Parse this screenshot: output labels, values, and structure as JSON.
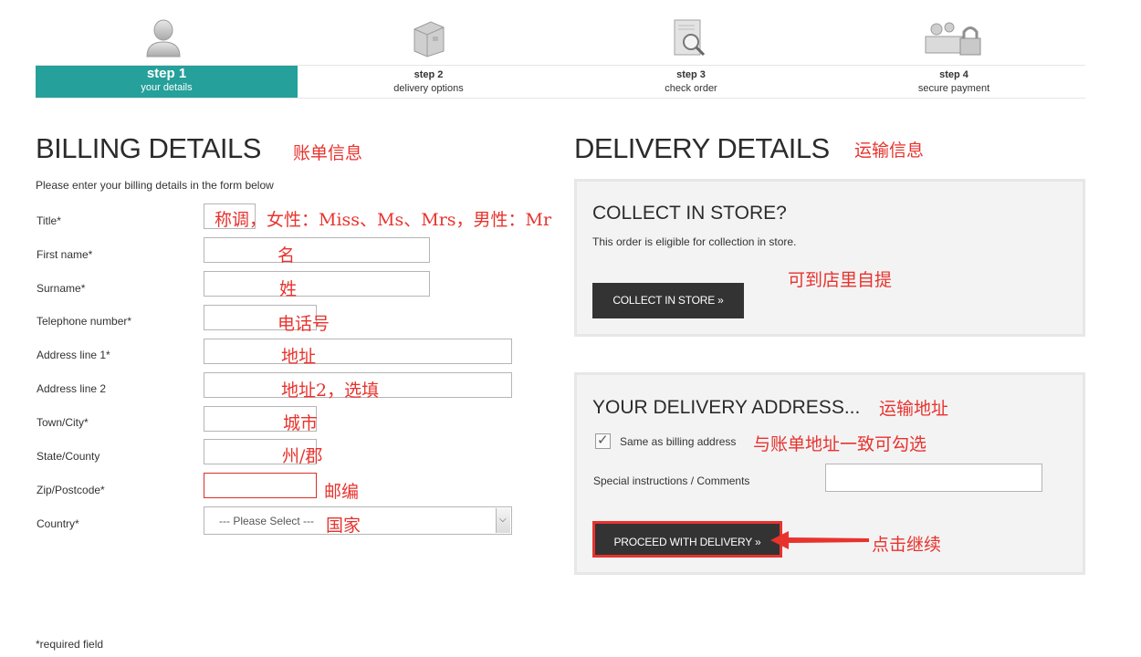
{
  "steps": [
    {
      "title": "step 1",
      "subtitle": "your details",
      "icon": "user-icon",
      "active": true
    },
    {
      "title": "step 2",
      "subtitle": "delivery options",
      "icon": "package-icon",
      "active": false
    },
    {
      "title": "step 3",
      "subtitle": "check order",
      "icon": "magnifier-document-icon",
      "active": false
    },
    {
      "title": "step 4",
      "subtitle": "secure payment",
      "icon": "padlock-money-icon",
      "active": false
    }
  ],
  "billing": {
    "heading": "BILLING DETAILS",
    "heading_note": "账单信息",
    "intro": "Please enter your billing details in the form below",
    "fields": {
      "title": {
        "label": "Title*",
        "note": "称调，女性：Miss、Ms、Mrs，男性：Mr"
      },
      "first_name": {
        "label": "First name*",
        "note": "名"
      },
      "surname": {
        "label": "Surname*",
        "note": "姓"
      },
      "telephone": {
        "label": "Telephone number*",
        "note": "电话号"
      },
      "address1": {
        "label": "Address line 1*",
        "note": "地址"
      },
      "address2": {
        "label": "Address line 2",
        "note": "地址2，选填"
      },
      "town": {
        "label": "Town/City*",
        "note": "城市"
      },
      "state": {
        "label": "State/County",
        "note": "州/郡"
      },
      "zip": {
        "label": "Zip/Postcode*",
        "note": "邮编"
      },
      "country": {
        "label": "Country*",
        "selected": "--- Please Select ---",
        "note": "国家"
      }
    },
    "required_note": "*required field"
  },
  "delivery": {
    "heading": "DELIVERY DETAILS",
    "heading_note": "运输信息",
    "collect": {
      "heading": "COLLECT IN STORE?",
      "text": "This order is eligible for collection in store.",
      "button": "COLLECT IN STORE »",
      "note": "可到店里自提"
    },
    "address": {
      "heading": "YOUR DELIVERY ADDRESS...",
      "heading_note": "运输地址",
      "same_as_billing": "Same as billing address",
      "same_as_billing_checked": true,
      "same_note": "与账单地址一致可勾选",
      "instructions_label": "Special instructions / Comments",
      "button": "PROCEED WITH DELIVERY »",
      "button_note": "点击继续"
    }
  },
  "colors": {
    "accent": "#25a09a",
    "annotation": "#e8332d",
    "button": "#333333"
  }
}
